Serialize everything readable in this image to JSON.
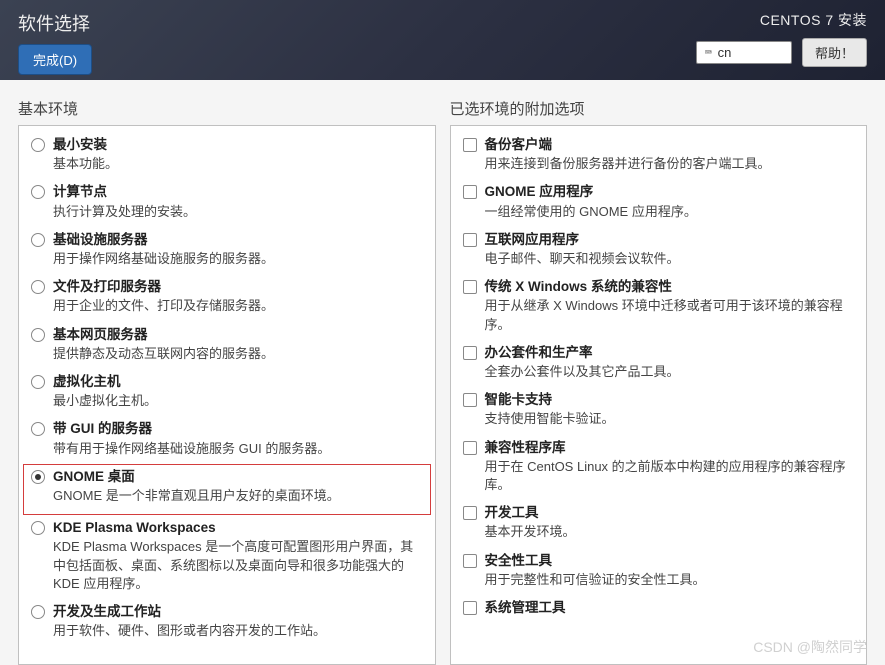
{
  "header": {
    "title": "软件选择",
    "done_label": "完成(D)",
    "installer_title": "CENTOS 7 安装",
    "kbd_layout": "cn",
    "help_label": "帮助！"
  },
  "left": {
    "heading": "基本环境",
    "items": [
      {
        "title": "最小安装",
        "desc": "基本功能。",
        "selected": false
      },
      {
        "title": "计算节点",
        "desc": "执行计算及处理的安装。",
        "selected": false
      },
      {
        "title": "基础设施服务器",
        "desc": "用于操作网络基础设施服务的服务器。",
        "selected": false
      },
      {
        "title": "文件及打印服务器",
        "desc": "用于企业的文件、打印及存储服务器。",
        "selected": false
      },
      {
        "title": "基本网页服务器",
        "desc": "提供静态及动态互联网内容的服务器。",
        "selected": false
      },
      {
        "title": "虚拟化主机",
        "desc": "最小虚拟化主机。",
        "selected": false
      },
      {
        "title": "带 GUI 的服务器",
        "desc": "带有用于操作网络基础设施服务 GUI 的服务器。",
        "selected": false
      },
      {
        "title": "GNOME 桌面",
        "desc": "GNOME 是一个非常直观且用户友好的桌面环境。",
        "selected": true,
        "highlighted": true
      },
      {
        "title": "KDE Plasma Workspaces",
        "desc": "KDE Plasma Workspaces 是一个高度可配置图形用户界面，其中包括面板、桌面、系统图标以及桌面向导和很多功能强大的 KDE 应用程序。",
        "selected": false
      },
      {
        "title": "开发及生成工作站",
        "desc": "用于软件、硬件、图形或者内容开发的工作站。",
        "selected": false
      }
    ]
  },
  "right": {
    "heading": "已选环境的附加选项",
    "items": [
      {
        "title": "备份客户端",
        "desc": "用来连接到备份服务器并进行备份的客户端工具。"
      },
      {
        "title": "GNOME 应用程序",
        "desc": "一组经常使用的 GNOME 应用程序。"
      },
      {
        "title": "互联网应用程序",
        "desc": "电子邮件、聊天和视频会议软件。"
      },
      {
        "title": "传统 X Windows 系统的兼容性",
        "desc": "用于从继承 X Windows 环境中迁移或者可用于该环境的兼容程序。"
      },
      {
        "title": "办公套件和生产率",
        "desc": "全套办公套件以及其它产品工具。"
      },
      {
        "title": "智能卡支持",
        "desc": "支持使用智能卡验证。"
      },
      {
        "title": "兼容性程序库",
        "desc": "用于在 CentOS Linux 的之前版本中构建的应用程序的兼容程序库。"
      },
      {
        "title": "开发工具",
        "desc": "基本开发环境。"
      },
      {
        "title": "安全性工具",
        "desc": "用于完整性和可信验证的安全性工具。"
      },
      {
        "title": "系统管理工具",
        "desc": ""
      }
    ]
  },
  "watermark": "CSDN @陶然同学"
}
